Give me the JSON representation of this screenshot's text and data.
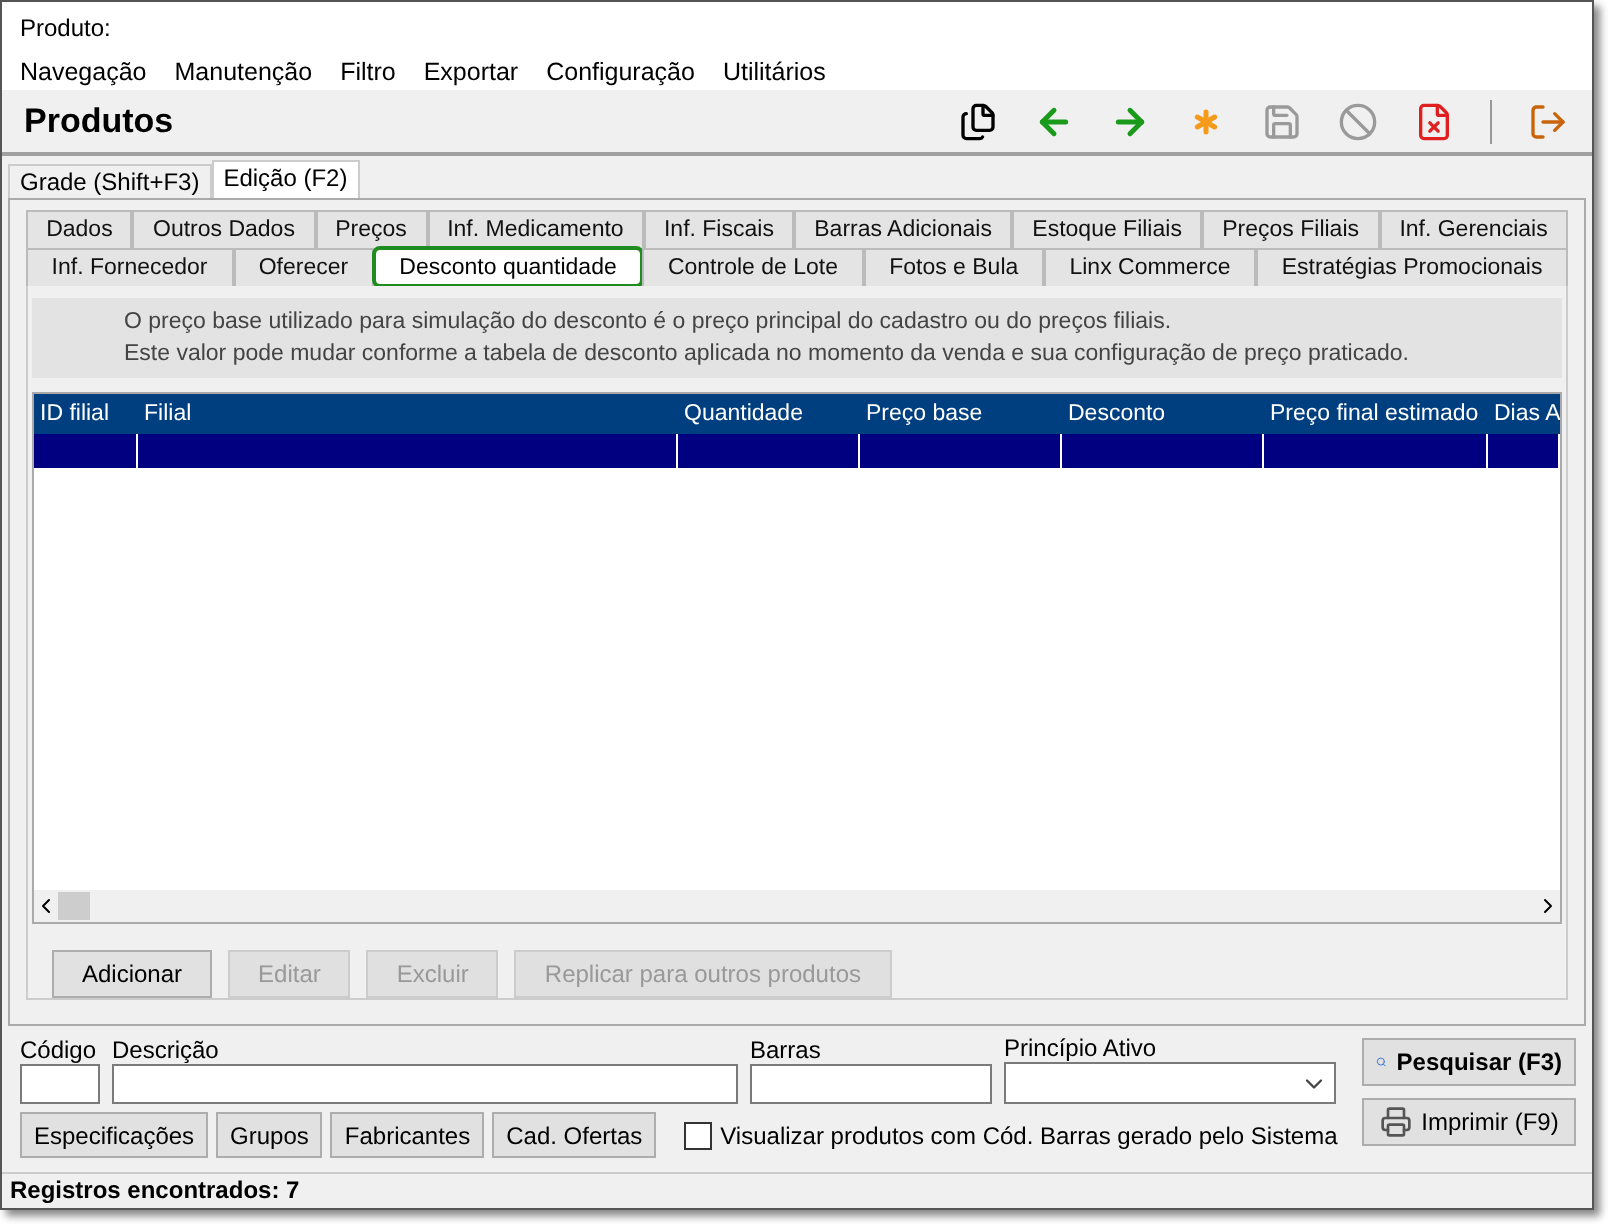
{
  "header": {
    "label": "Produto:"
  },
  "menu": [
    "Navegação",
    "Manutenção",
    "Filtro",
    "Exportar",
    "Configuração",
    "Utilitários"
  ],
  "title": "Produtos",
  "toolbar": [
    {
      "kind": "copy",
      "disabled": false
    },
    {
      "kind": "back",
      "disabled": false
    },
    {
      "kind": "forward",
      "disabled": false
    },
    {
      "kind": "new",
      "disabled": false
    },
    {
      "kind": "save",
      "disabled": true
    },
    {
      "kind": "cancel",
      "disabled": true
    },
    {
      "kind": "delete",
      "disabled": false
    },
    {
      "kind": "separator"
    },
    {
      "kind": "exit",
      "disabled": false
    }
  ],
  "view_tabs": [
    {
      "label": "Grade (Shift+F3)",
      "selected": false
    },
    {
      "label": "Edição (F2)",
      "selected": true
    }
  ],
  "tab_rows": [
    [
      {
        "label": "Dados",
        "selected": false,
        "highlighted": false
      },
      {
        "label": "Outros Dados",
        "selected": false,
        "highlighted": false
      },
      {
        "label": "Preços",
        "selected": false,
        "highlighted": false
      },
      {
        "label": "Inf. Medicamento",
        "selected": false,
        "highlighted": false
      },
      {
        "label": "Inf. Fiscais",
        "selected": false,
        "highlighted": false
      },
      {
        "label": "Barras Adicionais",
        "selected": false,
        "highlighted": false
      },
      {
        "label": "Estoque Filiais",
        "selected": false,
        "highlighted": false
      },
      {
        "label": "Preços Filiais",
        "selected": false,
        "highlighted": false
      },
      {
        "label": "Inf. Gerenciais",
        "selected": false,
        "highlighted": false
      }
    ],
    [
      {
        "label": "Inf. Fornecedor",
        "selected": false,
        "highlighted": false
      },
      {
        "label": "Oferecer",
        "selected": false,
        "highlighted": false
      },
      {
        "label": "Desconto quantidade",
        "selected": true,
        "highlighted": true
      },
      {
        "label": "Controle de Lote",
        "selected": false,
        "highlighted": false
      },
      {
        "label": "Fotos e Bula",
        "selected": false,
        "highlighted": false
      },
      {
        "label": "Linx Commerce",
        "selected": false,
        "highlighted": false
      },
      {
        "label": "Estratégias Promocionais",
        "selected": false,
        "highlighted": false
      }
    ]
  ],
  "info": [
    "O preço base utilizado para simulação do desconto é o preço principal do cadastro ou do preços filiais.",
    "Este valor pode mudar conforme a tabela de desconto aplicada no momento da venda e sua configuração de preço praticado."
  ],
  "table": {
    "columns": [
      "ID filial",
      "Filial",
      "Quantidade",
      "Preço base",
      "Desconto",
      "Preço final estimado",
      "Dias A"
    ],
    "rows": [
      {
        "selected": true
      }
    ]
  },
  "actions": [
    {
      "label": "Adicionar",
      "disabled": false
    },
    {
      "label": "Editar",
      "disabled": true
    },
    {
      "label": "Excluir",
      "disabled": true
    },
    {
      "label": "Replicar para outros produtos",
      "disabled": true
    }
  ],
  "search": {
    "fields": [
      {
        "label": "Código",
        "kind": "text"
      },
      {
        "label": "Descrição",
        "kind": "text"
      },
      {
        "label": "Barras",
        "kind": "text"
      },
      {
        "label": "Princípio Ativo",
        "kind": "select"
      }
    ],
    "buttons": [
      "Especificações",
      "Grupos",
      "Fabricantes",
      "Cad. Ofertas"
    ],
    "checkbox": {
      "label": "Visualizar produtos com Cód. Barras gerado pelo Sistema",
      "checked": false
    },
    "side_buttons": [
      {
        "label": "Pesquisar (F3)",
        "kind": "search"
      },
      {
        "label": "Imprimir (F9)",
        "kind": "print"
      }
    ]
  },
  "status_bar": "Registros encontrados: 7"
}
